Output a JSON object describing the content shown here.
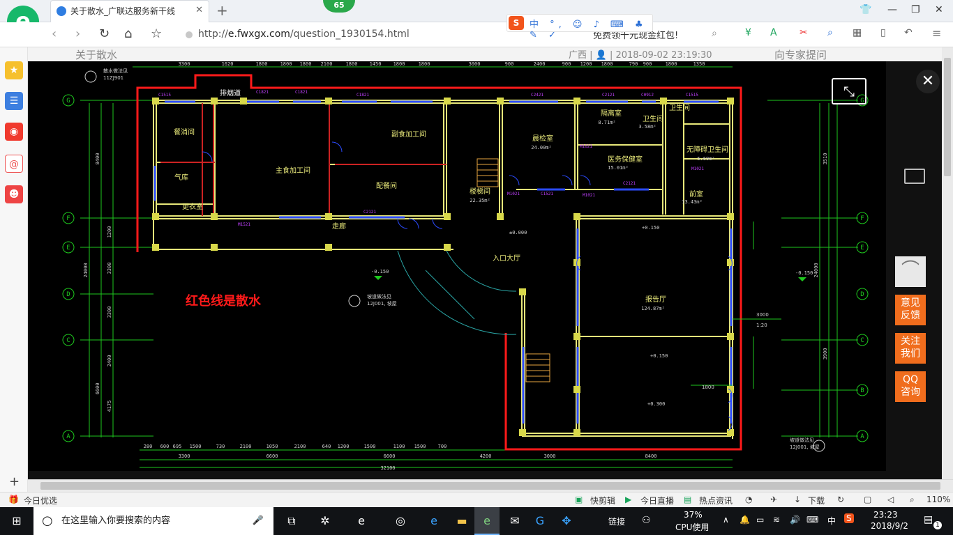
{
  "browser": {
    "tab_title": "关于散水_广联达服务新干线",
    "badge": "65",
    "url_host": "e.fwxgx.com",
    "url_prefix": "http://",
    "url_path": "/question_1930154.html",
    "sogou_items": "中 °, ☺ ♪ ⌨ ♣ ✎ ✓",
    "promo": "免费领千元现金红包!"
  },
  "page_behind": {
    "title": "关于散水",
    "meta": "广西 | 👤 | 2018-09-02 23:19:30",
    "ask": "向专家提问"
  },
  "viewer": {
    "float_buttons": [
      {
        "label": "意见\n反馈"
      },
      {
        "label": "关注\n我们"
      },
      {
        "label": "QQ\n咨询"
      }
    ]
  },
  "drawing": {
    "annotation": "红色线是散水",
    "top_dims": [
      "3300",
      "1620",
      "1800",
      "1800",
      "1800",
      "2100",
      "1800",
      "1450",
      "1800",
      "1800",
      "3000",
      "900",
      "2400",
      "900",
      "1200",
      "1800",
      "790",
      "900",
      "1800",
      "1350"
    ],
    "bottom_dims_row1": [
      "280",
      "600",
      "695",
      "1500",
      "730",
      "2100",
      "1050",
      "2100",
      "640",
      "1200",
      "1500",
      "1100",
      "1500",
      "700"
    ],
    "bottom_dims_row2": [
      "3300",
      "6600",
      "6600",
      "4200",
      "3000",
      "8400"
    ],
    "bottom_total": "32100",
    "axis_letters_left": [
      "G",
      "F",
      "E",
      "D",
      "C",
      "B",
      "A"
    ],
    "left_dims": [
      "8400",
      "6600",
      "5500",
      "2400",
      "3300",
      "4175",
      "2400",
      "1200",
      "750",
      "875",
      "2400"
    ],
    "rooms": [
      {
        "name": "餐消间"
      },
      {
        "name": "气库"
      },
      {
        "name": "主食加工间"
      },
      {
        "name": "副食加工间"
      },
      {
        "name": "配餐间"
      },
      {
        "name": "更衣室"
      },
      {
        "name": "走廊"
      },
      {
        "name": "楼梯间"
      },
      {
        "name": "晨检室"
      },
      {
        "name": "隔离室"
      },
      {
        "name": "卫生间"
      },
      {
        "name": "医务保健室"
      },
      {
        "name": "无障碍卫生间"
      },
      {
        "name": "前室"
      },
      {
        "name": "入口大厅"
      },
      {
        "name": "报告厅"
      },
      {
        "name": "门厅"
      },
      {
        "name": "排烟道"
      }
    ],
    "room_areas": {
      "stair": "22.35m²",
      "check": "24.00m²",
      "isolation": "8.71m²",
      "wc": "3.58m²",
      "clinic": "15.01m²",
      "accessible_wc": "5.69m²",
      "front": "13.43m²",
      "hall": "124.87m²"
    },
    "elevations": [
      "±0.000",
      "-0.150",
      "+0.150",
      "+0.150",
      "+0.300",
      "-0.150"
    ],
    "notes": [
      "散水做法见",
      "11ZJ901",
      "坡道做法见",
      "12J001, 坡屋",
      "坡道做法见",
      "12J001, 坡屋"
    ],
    "small_labels": [
      "C1515",
      "C1821",
      "C1821",
      "C1821",
      "C2421",
      "C2121",
      "C0912",
      "C1515",
      "M1021",
      "M1521",
      "C2121",
      "M1021",
      "M1021",
      "C1521",
      "C2121",
      "M1021"
    ],
    "ratio": "1:20",
    "dim_3000": "3000",
    "dim_1800": "1800",
    "dim_3300": "3300"
  },
  "statusbar": {
    "left": "今日优选",
    "items": [
      "快剪辑",
      "今日直播",
      "热点资讯",
      "下载"
    ],
    "zoom": "110%"
  },
  "taskbar": {
    "search_placeholder": "在这里输入你要搜索的内容",
    "link_label": "链接",
    "cpu": "37%",
    "cpu_label": "CPU使用",
    "ime": "中",
    "time": "23:23",
    "date": "2018/9/2",
    "notif": "1"
  },
  "colors": {
    "accent_green": "#17b86a",
    "cad_bg": "#000000",
    "wall_yellow": "#e8e87a",
    "dim_green": "#1ec81e",
    "red_line": "#ff1a1a",
    "fab_orange": "#f06d1d"
  }
}
